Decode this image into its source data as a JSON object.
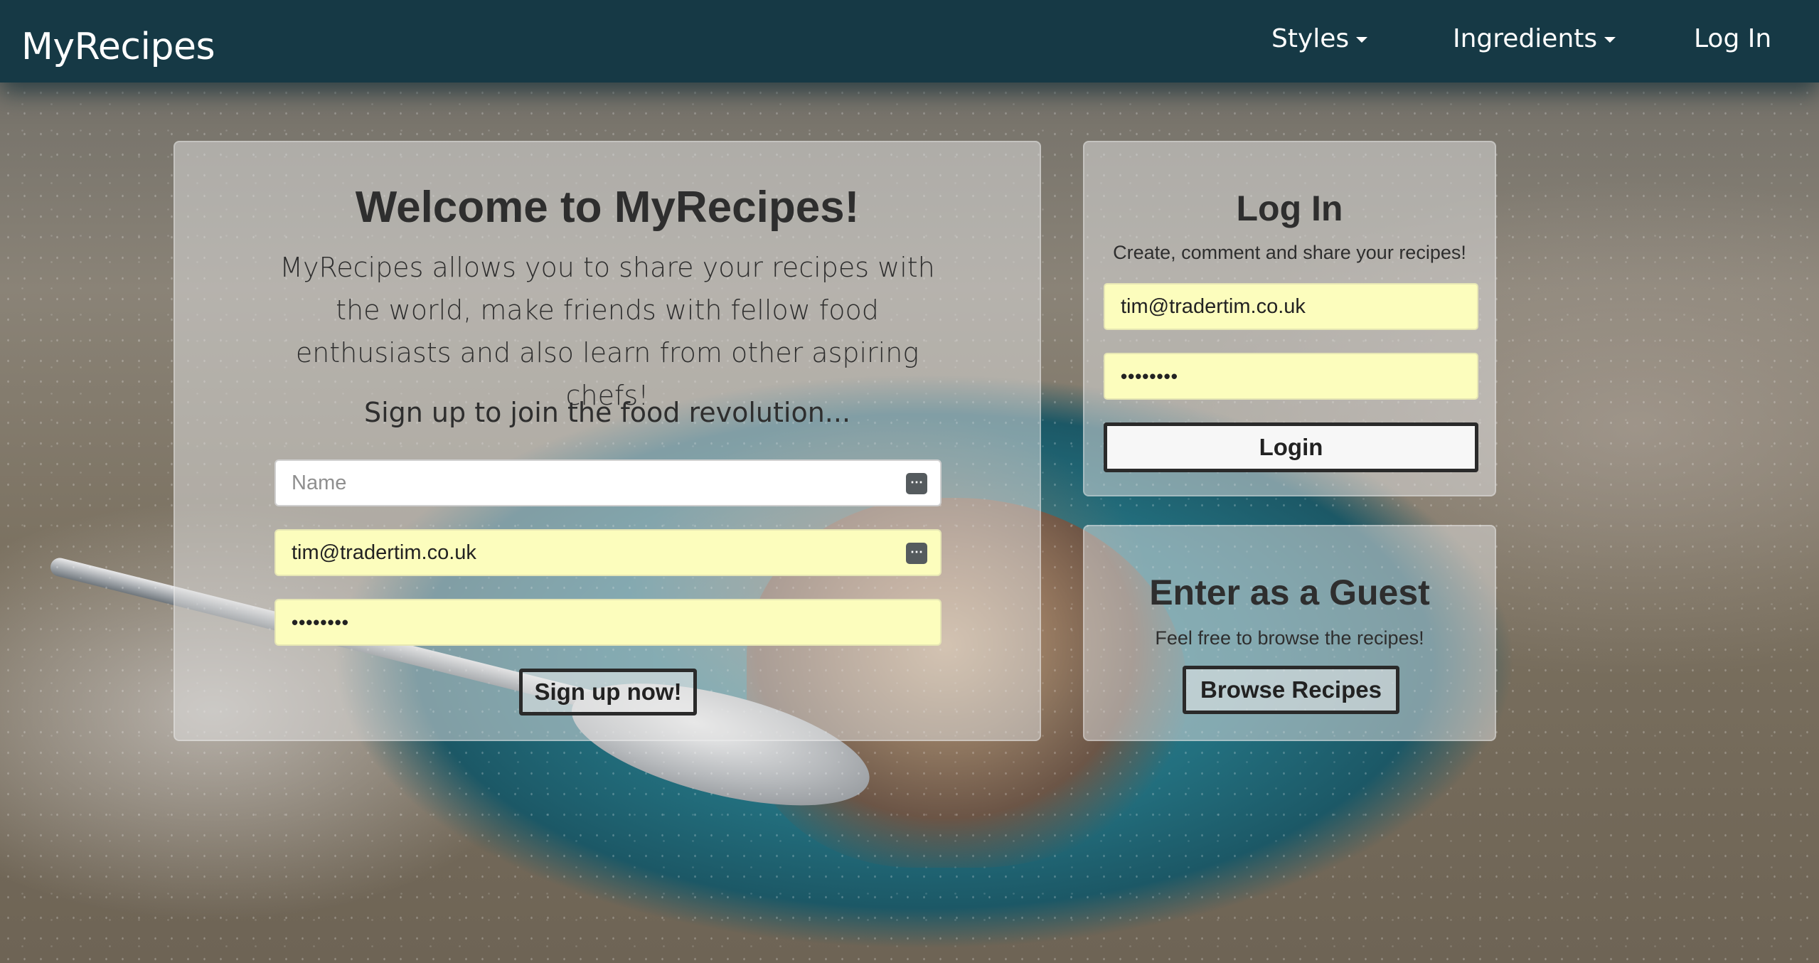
{
  "navbar": {
    "brand": "MyRecipes",
    "items": [
      {
        "label": "Styles",
        "has_dropdown": true
      },
      {
        "label": "Ingredients",
        "has_dropdown": true
      },
      {
        "label": "Log In",
        "has_dropdown": false
      }
    ],
    "background_color": "#163945"
  },
  "welcome": {
    "title": "Welcome to MyRecipes!",
    "intro": "MyRecipes allows you to share your recipes with the world, make friends with fellow food enthusiasts and also learn from other aspiring chefs!",
    "signup_prompt": "Sign up to join the food revolution...",
    "form": {
      "name_placeholder": "Name",
      "email_value": "tim@tradertim.co.uk",
      "password_value": "••••••••",
      "submit_label": "Sign up now!"
    }
  },
  "login": {
    "title": "Log In",
    "subtitle": "Create, comment and share your recipes!",
    "email_value": "tim@tradertim.co.uk",
    "password_value": "••••••••",
    "submit_label": "Login"
  },
  "guest": {
    "title": "Enter as a Guest",
    "subtitle": "Feel free to browse the recipes!",
    "button_label": "Browse Recipes"
  },
  "colors": {
    "autofill_yellow": "#fcfdbd",
    "panel_overlay": "rgba(222,222,222,0.52)",
    "text_dark": "#2e2e2e"
  },
  "icons": {
    "name_field_icon": "password-manager-icon",
    "email_field_icon": "autofill-keys-icon"
  }
}
